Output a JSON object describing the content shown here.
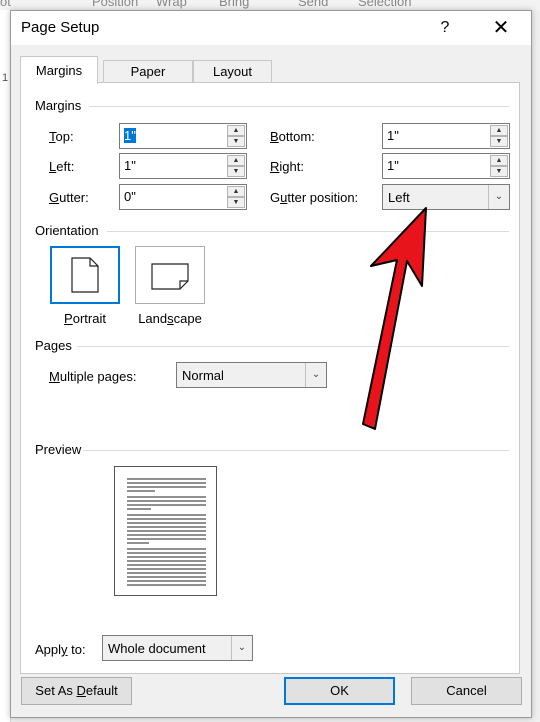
{
  "background": {
    "ribbon_items": [
      "Position",
      "Wrap",
      "Bring",
      "Send",
      "Selection"
    ],
    "line_number": "1",
    "edge_text": "ot"
  },
  "dialog": {
    "title": "Page Setup",
    "help_glyph": "?",
    "close_glyph": "✕"
  },
  "tabs": [
    {
      "label": "Margins",
      "active": true
    },
    {
      "label": "Paper",
      "active": false
    },
    {
      "label": "Layout",
      "active": false
    }
  ],
  "margins": {
    "section_label": "Margins",
    "top": {
      "label_key": "T",
      "label_rest": "op:",
      "value": "1\""
    },
    "left": {
      "label_key": "L",
      "label_rest": "eft:",
      "value": "1\""
    },
    "gutter": {
      "label_key": "G",
      "label_rest": "utter:",
      "value": "0\""
    },
    "bottom": {
      "label_key": "B",
      "label_rest": "ottom:",
      "value": "1\""
    },
    "right": {
      "label_key": "R",
      "label_rest": "ight:",
      "value": "1\""
    },
    "gutter_position": {
      "label_pre": "G",
      "label_key": "u",
      "label_rest": "tter position:",
      "value": "Left"
    }
  },
  "orientation": {
    "section_label": "Orientation",
    "portrait": {
      "label_key": "P",
      "label_rest": "ortrait",
      "selected": true
    },
    "landscape": {
      "label_pre": "Land",
      "label_key": "s",
      "label_rest": "cape",
      "selected": false
    }
  },
  "pages": {
    "section_label": "Pages",
    "multiple_pages": {
      "label_key": "M",
      "label_rest": "ultiple pages:",
      "value": "Normal"
    }
  },
  "preview": {
    "section_label": "Preview"
  },
  "apply_to": {
    "label_pre": "Appl",
    "label_key": "y",
    "label_rest": " to:",
    "value": "Whole document"
  },
  "buttons": {
    "set_default": {
      "label_pre": "Set As ",
      "label_key": "D",
      "label_rest": "efault"
    },
    "ok": "OK",
    "cancel": "Cancel"
  },
  "colors": {
    "accent": "#0078d7",
    "annotation_arrow": "#e8141b"
  }
}
